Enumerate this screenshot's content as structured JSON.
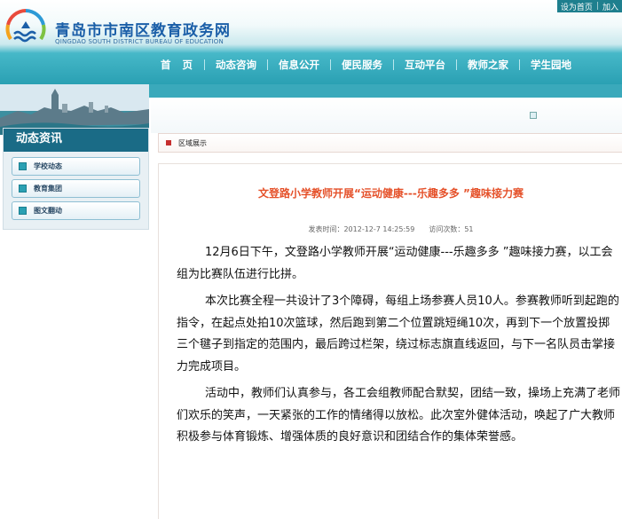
{
  "header": {
    "site_name_cn": "青岛市市南区教育政务网",
    "site_name_en": "QINGDAO SOUTH DISTRICT BUREAU OF EDUCATION",
    "top_links": [
      "设为首页",
      "加入"
    ]
  },
  "nav": {
    "items": [
      "首页",
      "动态咨询",
      "信息公开",
      "便民服务",
      "互动平台",
      "教师之家",
      "学生园地"
    ]
  },
  "sidebar": {
    "title": "动态资讯",
    "items": [
      "学校动态",
      "教育集团",
      "图文翻动"
    ]
  },
  "breadcrumb": {
    "label": "区域展示"
  },
  "article": {
    "title": "文登路小学教师开展“运动健康---乐趣多多 ”趣味接力赛",
    "publish_label": "发表时间：",
    "publish_time": "2012-12-7 14:25:59",
    "views_label": "访问次数：",
    "views": "51",
    "paragraphs": [
      "12月6日下午，文登路小学教师开展“运动健康---乐趣多多 ”趣味接力赛，以工会组为比赛队伍进行比拼。",
      "本次比赛全程一共设计了3个障碍，每组上场参赛人员10人。参赛教师听到起跑的指令，在起点处拍10次篮球，然后跑到第二个位置跳短绳10次，再到下一个放置投掷三个毽子到指定的范围内，最后跨过栏架，绕过标志旗直线返回，与下一名队员击掌接力完成项目。",
      "活动中，教师们认真参与，各工会组教师配合默契，团结一致，操场上充满了老师们欢乐的笑声，一天紧张的工作的情绪得以放松。此次室外健体活动，唤起了广大教师积极参与体育锻炼、增强体质的良好意识和团结合作的集体荣誉感。"
    ]
  },
  "colors": {
    "accent": "#2aa0b3",
    "title": "#e5512a",
    "brand": "#1b5fa8"
  }
}
